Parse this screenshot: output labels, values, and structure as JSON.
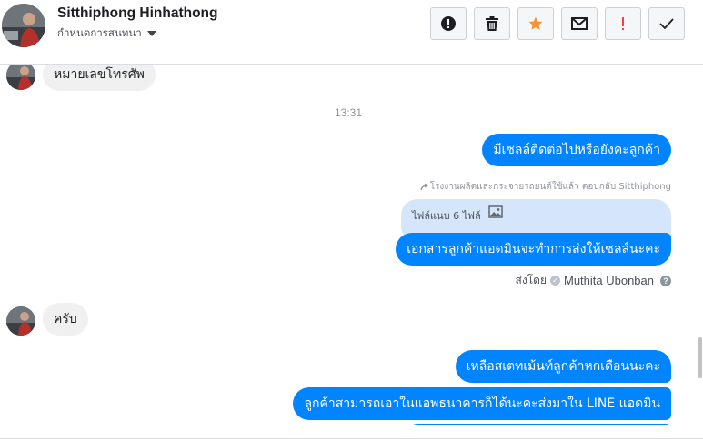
{
  "header": {
    "name": "Sitthiphong Hinhathong",
    "subtitle": "กำหนดการสนทนา",
    "actions": [
      {
        "name": "mark-spam-button",
        "icon": "exclamation-circle-icon"
      },
      {
        "name": "delete-button",
        "icon": "trash-icon"
      },
      {
        "name": "star-button",
        "icon": "star-icon",
        "color": "#f7923b"
      },
      {
        "name": "mark-unread-button",
        "icon": "envelope-icon"
      },
      {
        "name": "important-button",
        "icon": "exclamation-icon",
        "color": "#fa3e3e"
      },
      {
        "name": "mark-done-button",
        "icon": "checkmark-icon"
      }
    ]
  },
  "messages": {
    "incoming_1": "หมายเลขโทรศัพ",
    "time_1": "13:31",
    "outgoing_1": "มีเซลล์ติดต่อไปหรือยังคะลูกค้า",
    "reply_note": "โรงงานผลิตและกระจายรถยนต์ใช้แล้ว ตอบกลับ Sitthiphong",
    "quoted_files": "ไฟล์แนบ 6 ไฟล์",
    "outgoing_2": "เอกสารลูกค้าแอดมินจะทำการส่งให้เซลล์นะคะ",
    "sent_by_label": "ส่งโดย",
    "sent_by_name": "Muthita Ubonban",
    "incoming_2": "ครับ",
    "outgoing_3": "เหลือสเตทเม้นท์ลูกค้าหกเดือนนะคะ",
    "outgoing_4": "ลูกค้าสามารถเอาในแอพธนาคารก็ได้นะคะส่งมาใน LINE แอดมิน"
  },
  "colors": {
    "outgoing_bubble": "#0084ff",
    "incoming_bubble": "#f0f0f0",
    "quoted_bubble": "#d5e6fb"
  }
}
